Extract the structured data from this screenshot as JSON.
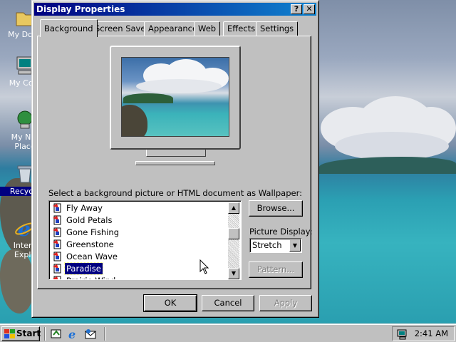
{
  "desktop": {
    "icons": [
      {
        "label": "My Docu",
        "icon": "my-documents-icon"
      },
      {
        "label": "My Com",
        "icon": "my-computer-icon"
      },
      {
        "label": "My Net",
        "label2": "Place",
        "icon": "network-icon"
      },
      {
        "label": "Recycle",
        "icon": "recycle-bin-icon"
      },
      {
        "label": "Intern",
        "label2": "Explo",
        "icon": "internet-explorer-icon"
      }
    ]
  },
  "window": {
    "title": "Display Properties",
    "help_glyph": "?",
    "close_glyph": "✕",
    "tabs": [
      {
        "label": "Background",
        "active": true
      },
      {
        "label": "Screen Saver"
      },
      {
        "label": "Appearance"
      },
      {
        "label": "Web"
      },
      {
        "label": "Effects"
      },
      {
        "label": "Settings"
      }
    ],
    "wallpaper_label": "Select a background picture or HTML document as Wallpaper:",
    "wallpaper_list": [
      {
        "name": "Fly Away"
      },
      {
        "name": "Gold Petals"
      },
      {
        "name": "Gone Fishing"
      },
      {
        "name": "Greenstone"
      },
      {
        "name": "Ocean Wave"
      },
      {
        "name": "Paradise",
        "selected": true
      },
      {
        "name": "Prairie Wind"
      }
    ],
    "browse_label": "Browse...",
    "picture_display_label": "Picture Display:",
    "picture_display_value": "Stretch",
    "pattern_label": "Pattern...",
    "ok_label": "OK",
    "cancel_label": "Cancel",
    "apply_label": "Apply"
  },
  "taskbar": {
    "start_label": "Start",
    "clock": "2:41 AM",
    "quick_launch": [
      "show-desktop-icon",
      "internet-explorer-icon",
      "outlook-express-icon"
    ]
  },
  "colors": {
    "titlebar_start": "#000080",
    "titlebar_end": "#1084d0",
    "face": "#c0c0c0",
    "selection": "#000080"
  }
}
